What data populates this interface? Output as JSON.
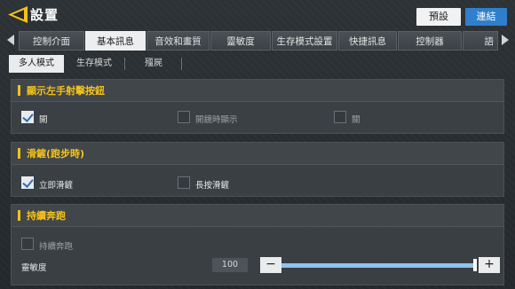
{
  "header": {
    "title": "設置",
    "preset_label": "預設",
    "link_label": "連結"
  },
  "tabs": [
    {
      "label": "控制介面",
      "active": false
    },
    {
      "label": "基本訊息",
      "active": true
    },
    {
      "label": "音效和畫質",
      "active": false
    },
    {
      "label": "靈敏度",
      "active": false
    },
    {
      "label": "生存模式設置",
      "active": false
    },
    {
      "label": "快捷訊息",
      "active": false
    },
    {
      "label": "控制器",
      "active": false
    },
    {
      "label": "語",
      "active": false
    }
  ],
  "subtabs": [
    {
      "label": "多人模式",
      "active": true
    },
    {
      "label": "生存模式",
      "active": false
    },
    {
      "label": "殭屍",
      "active": false
    }
  ],
  "sections": {
    "left_fire": {
      "title": "顯示左手射擊按鈕",
      "options": [
        {
          "label": "開",
          "checked": true
        },
        {
          "label": "開鏡時顯示",
          "checked": false
        },
        {
          "label": "關",
          "checked": false
        }
      ]
    },
    "slide": {
      "title": "滑鏟(跑步時)",
      "options": [
        {
          "label": "立即滑鏟",
          "checked": true
        },
        {
          "label": "長按滑鏟",
          "checked": false
        }
      ]
    },
    "sprint": {
      "title": "持續奔跑",
      "option": {
        "label": "持續奔跑",
        "checked": false
      },
      "sensitivity_label": "靈敏度",
      "sensitivity_value": "100",
      "slider_fraction": 1.0,
      "minus": "−",
      "plus": "+"
    }
  },
  "colors": {
    "accent": "#f3c21a",
    "link_button": "#2f7fcc",
    "slider_fill": "#8fc3ee"
  }
}
